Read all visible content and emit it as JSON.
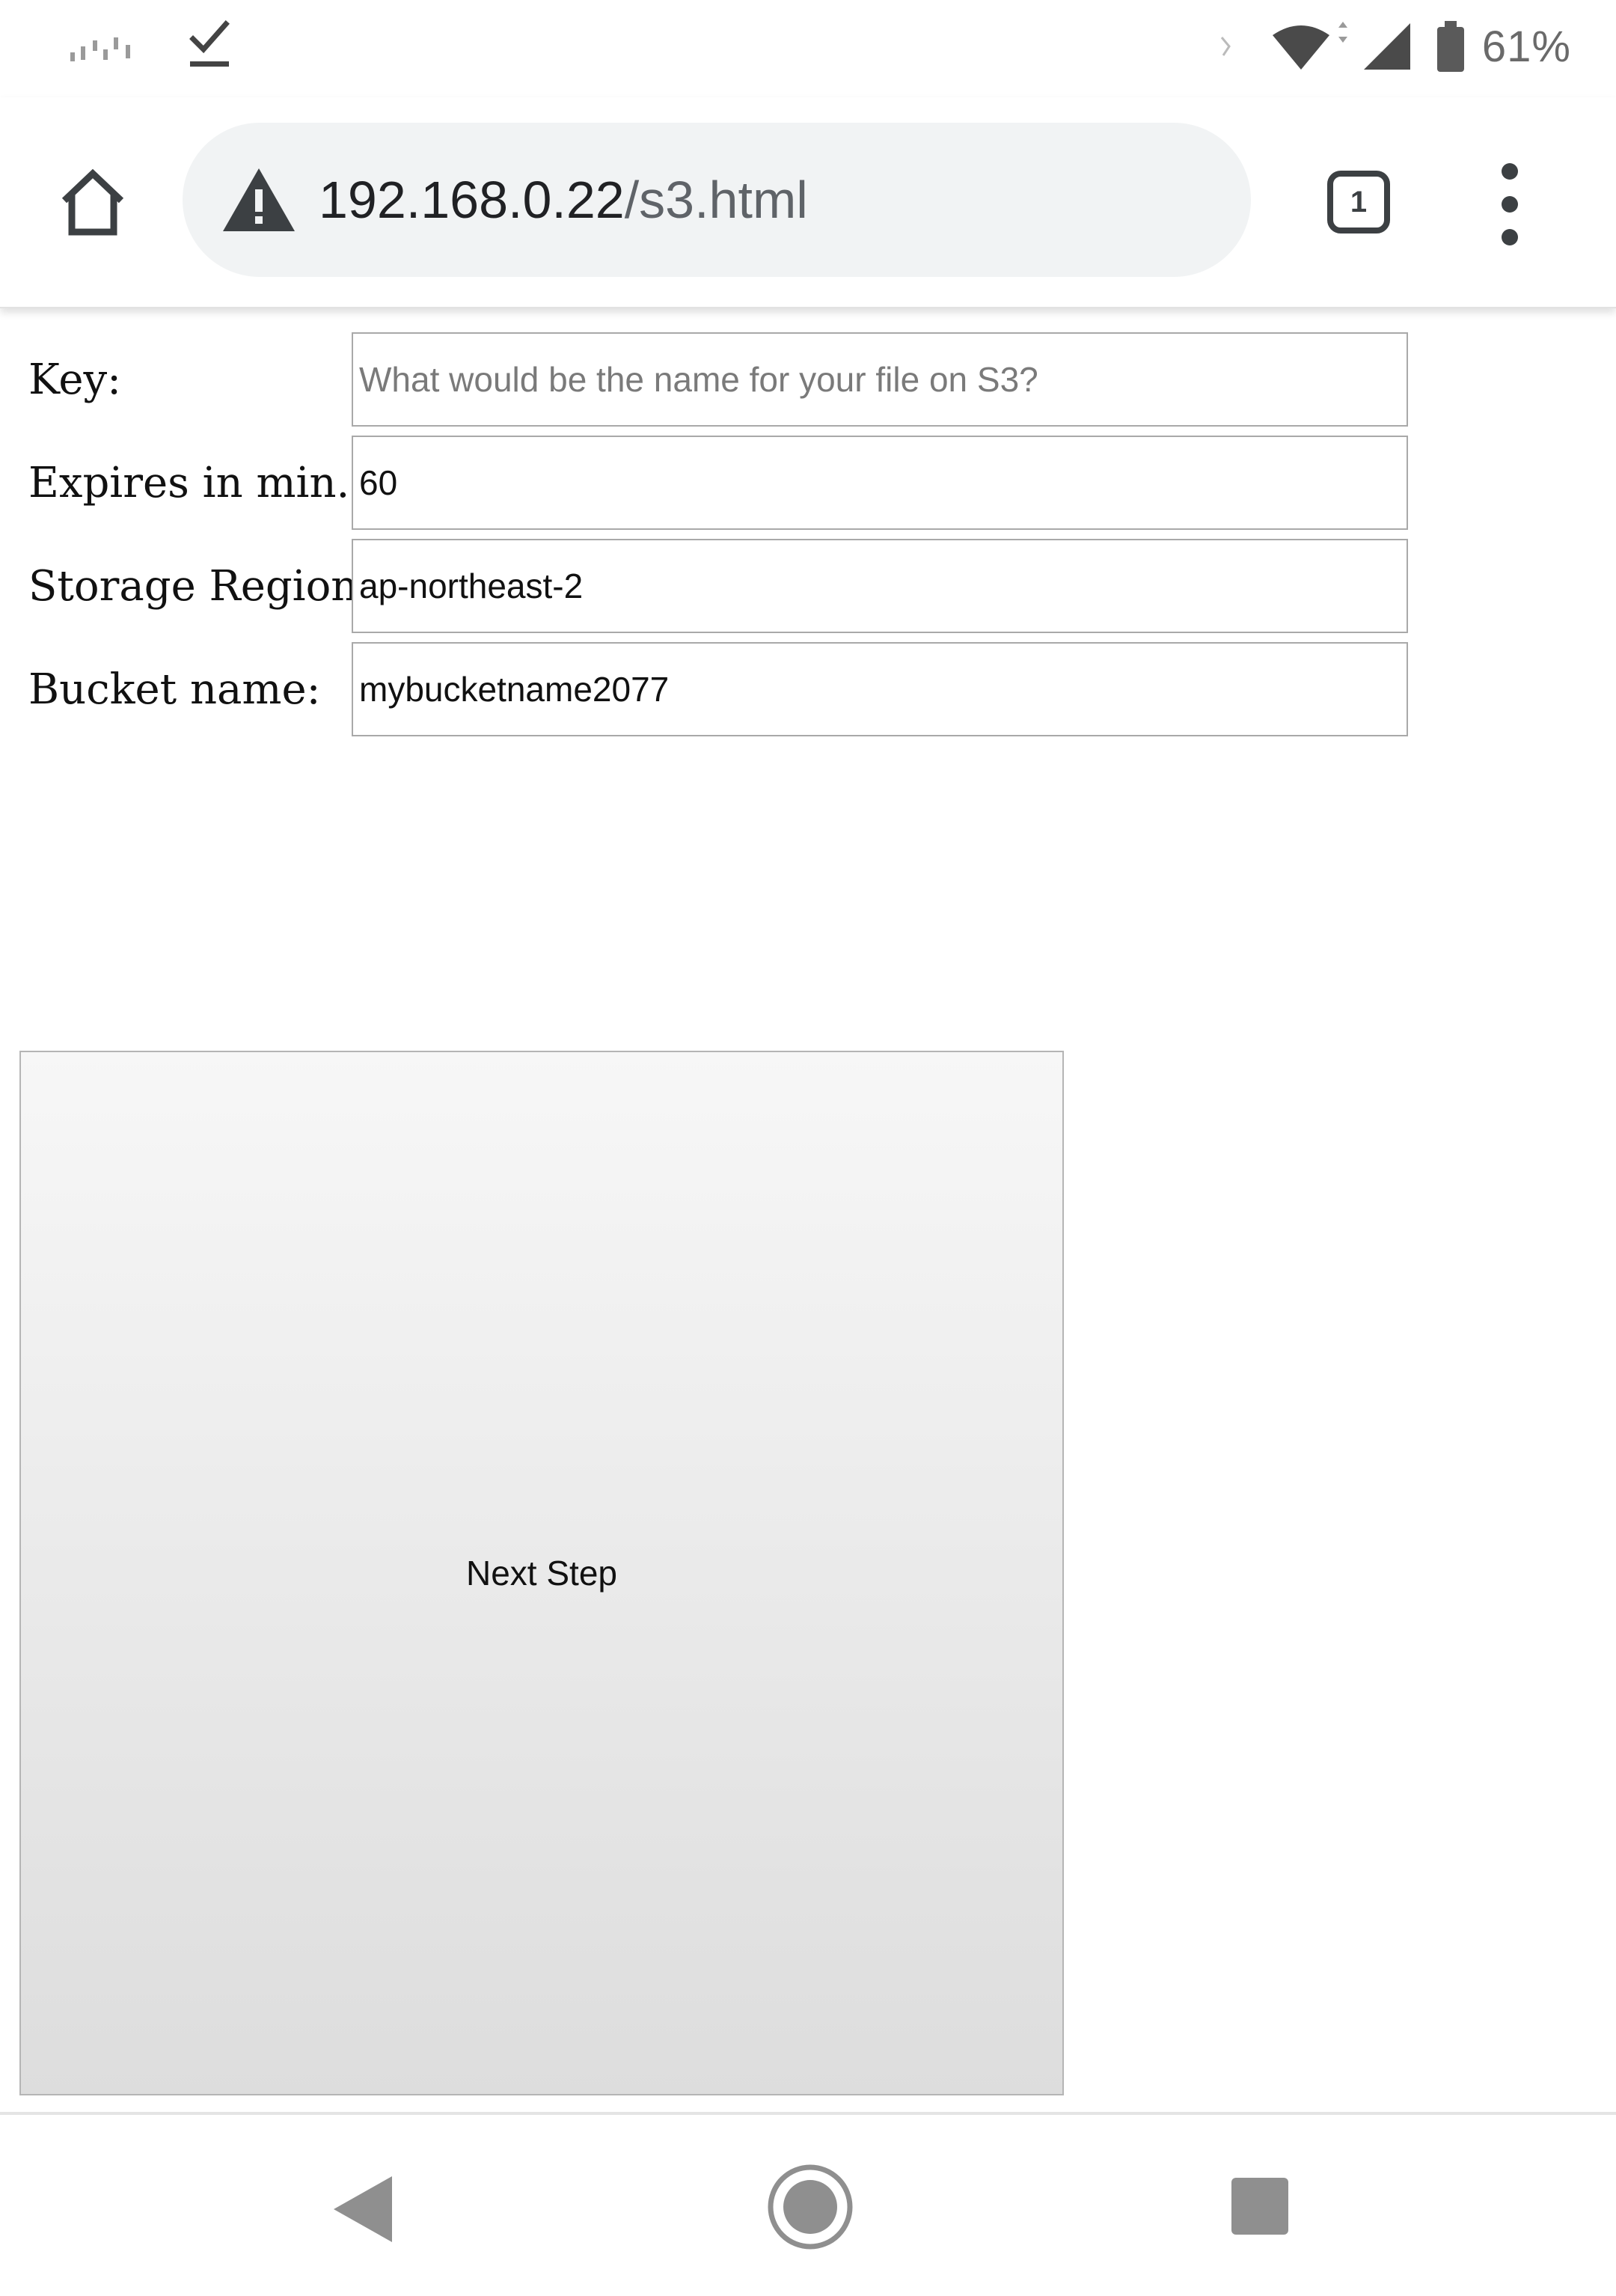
{
  "status_bar": {
    "battery_percent": "61%",
    "icons": [
      "notification-dots-icon",
      "download-done-icon",
      "wifi-icon",
      "cell-signal-icon",
      "battery-icon"
    ]
  },
  "browser": {
    "url_host": "192.168.0.22",
    "url_path": "/s3.html",
    "tab_count": "1",
    "security_icon": "warning-triangle-icon"
  },
  "form": {
    "key": {
      "label": "Key:",
      "value": "",
      "placeholder": "What would be the name for your file on S3?"
    },
    "expires": {
      "label": "Expires in min.:",
      "value": "60"
    },
    "region": {
      "label": "Storage Region:",
      "value": "ap-northeast-2"
    },
    "bucket": {
      "label": "Bucket name:",
      "value": "mybucketname2077"
    },
    "submit_label": "Next Step"
  },
  "nav": {
    "icons": [
      "back-icon",
      "home-circle-icon",
      "recents-square-icon"
    ]
  }
}
